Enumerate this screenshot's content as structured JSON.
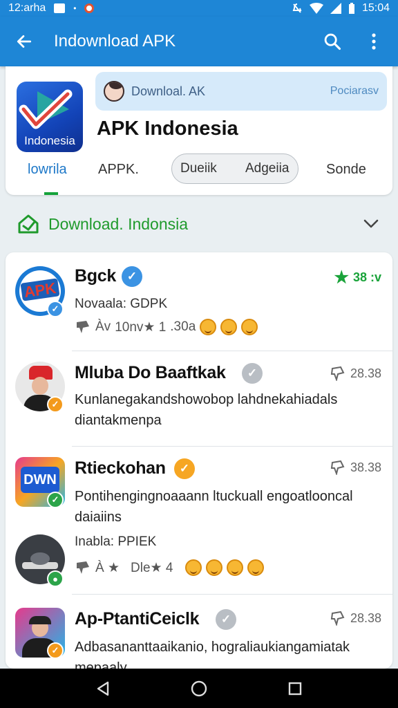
{
  "status_bar": {
    "time_left": "12:arha",
    "time_right": "15:04"
  },
  "app_bar": {
    "title": "Indownload APK",
    "back_icon": "arrow-back-icon",
    "search_icon": "search-icon",
    "menu_icon": "more-vert-icon"
  },
  "header": {
    "app_icon_label": "Indonesia",
    "promo_text": "Downloal. AK",
    "promo_right": "Pociarasv",
    "app_name": "APK Indonesia",
    "tabs": [
      {
        "label": "lowrila",
        "active": true
      },
      {
        "label": "APPK."
      },
      {
        "label": "Dueiik"
      },
      {
        "label": "Adgeiia"
      },
      {
        "label": "Sonde"
      }
    ]
  },
  "section": {
    "title": "Download. Indonsia"
  },
  "items": [
    {
      "name": "Bgck",
      "meta": "38 :v",
      "sub": "Novaala: GDPK",
      "stats": [
        "Àv",
        "10nv★ 1",
        ".30a"
      ],
      "colors": {
        "verify": "#3b93e3",
        "badge": "#3b93e3"
      }
    },
    {
      "name": "Mluba Do Baaftkak",
      "meta": "28.38",
      "body": "Kunlanegakandshowobop lahdnekahiadals diantakmenpa",
      "colors": {
        "verify": "#b9bec4",
        "badge": "#f39a1c"
      }
    },
    {
      "name": "Rtieckohan",
      "meta": "38.38",
      "body": "Pontihengingnoaaann ltuckuall engoatlooncal daiaiins",
      "sub": "Inabla: PPIEK",
      "stats": [
        "À ★",
        "Dle★ 4"
      ],
      "colors": {
        "verify": "#f6a623",
        "badge": "#2ca44a"
      }
    },
    {
      "name": "Ap-PtantiCeiclk",
      "meta": "28.38",
      "body": "Adbasananttaaikanio, hograliaukiangamiatak mepaaly",
      "colors": {
        "verify": "#b9bec4",
        "badge": "#f39a1c"
      }
    }
  ],
  "apk_logo_text": "APK",
  "game_logo_text": "DWN"
}
